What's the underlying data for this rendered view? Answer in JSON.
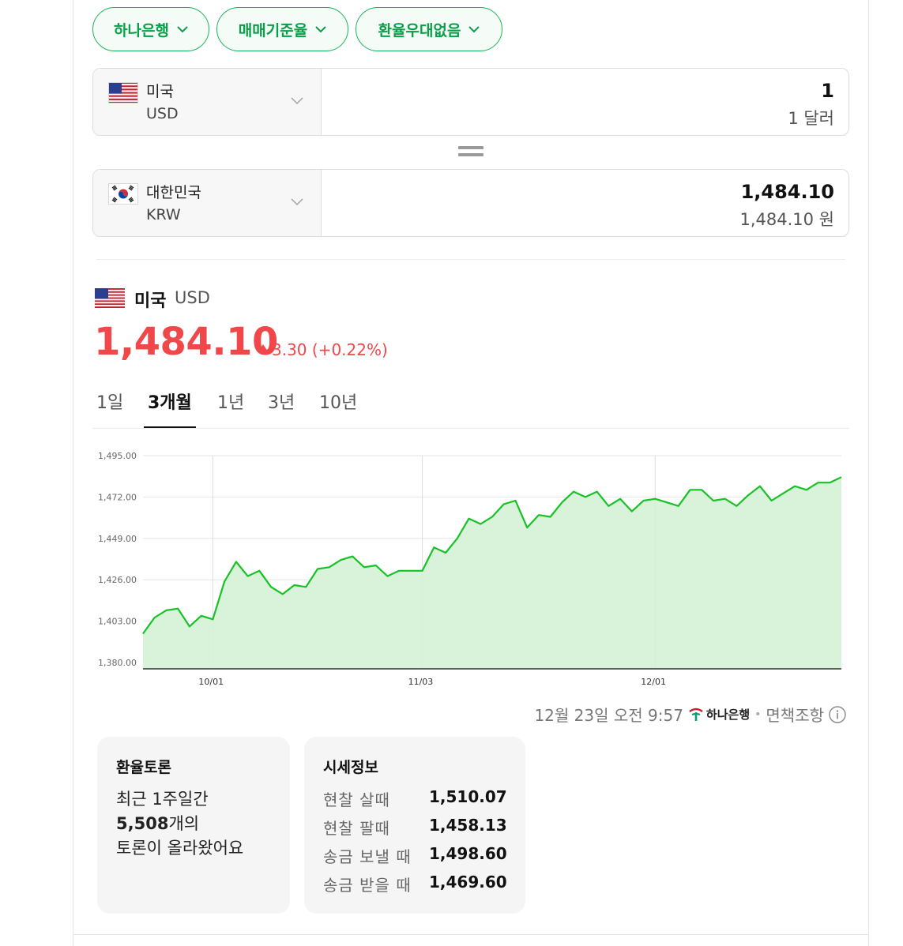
{
  "filters": [
    {
      "label": "하나은행"
    },
    {
      "label": "매매기준율"
    },
    {
      "label": "환율우대없음"
    }
  ],
  "converter": {
    "from": {
      "country": "미국",
      "code": "USD",
      "amount": "1",
      "amount_text": "1 달러"
    },
    "to": {
      "country": "대한민국",
      "code": "KRW",
      "amount": "1,484.10",
      "amount_text": "1,484.10 원"
    }
  },
  "rate": {
    "country": "미국",
    "code": "USD",
    "value": "1,484.10",
    "change": "3.30 (+0.22%)",
    "direction": "up"
  },
  "tabs": [
    {
      "label": "1일",
      "active": false
    },
    {
      "label": "3개월",
      "active": true
    },
    {
      "label": "1년",
      "active": false
    },
    {
      "label": "3년",
      "active": false
    },
    {
      "label": "10년",
      "active": false
    }
  ],
  "chart_data": {
    "type": "area",
    "y_ticks": [
      "1,495.00",
      "1,472.00",
      "1,449.00",
      "1,426.00",
      "1,403.00",
      "1,380.00"
    ],
    "ylim": [
      1380,
      1495
    ],
    "x_ticks": [
      "10/01",
      "11/03",
      "12/01"
    ],
    "x_tick_index": [
      6,
      24,
      44
    ],
    "grid": true,
    "line_color": "#17c225",
    "fill_color": "#d5f2d6",
    "values": [
      1396,
      1405,
      1409,
      1410,
      1400,
      1406,
      1404,
      1425,
      1436,
      1428,
      1431,
      1422,
      1418,
      1423,
      1422,
      1432,
      1433,
      1437,
      1439,
      1433,
      1434,
      1428,
      1431,
      1431,
      1431,
      1444,
      1441,
      1449,
      1460,
      1457,
      1461,
      1468,
      1470,
      1455,
      1462,
      1461,
      1469,
      1475,
      1472,
      1475,
      1467,
      1471,
      1464,
      1470,
      1471,
      1469,
      1467,
      1476,
      1476,
      1470,
      1471,
      1467,
      1473,
      1478,
      1470,
      1474,
      1478,
      1476,
      1480,
      1480,
      1483
    ]
  },
  "source": {
    "time": "12월 23일 오전 9:57",
    "bank": "하나은행",
    "disclaimer": "면책조항"
  },
  "discussion": {
    "title": "환율토론",
    "line1": "최근 1주일간",
    "count": "5,508",
    "count_suffix": "개의",
    "line3": "토론이 올라왔어요"
  },
  "market_info": {
    "title": "시세정보",
    "rows": [
      {
        "label": "현찰 살때",
        "value": "1,510.07"
      },
      {
        "label": "현찰 팔때",
        "value": "1,458.13"
      },
      {
        "label": "송금 보낼 때",
        "value": "1,498.60"
      },
      {
        "label": "송금 받을 때",
        "value": "1,469.60"
      }
    ]
  }
}
